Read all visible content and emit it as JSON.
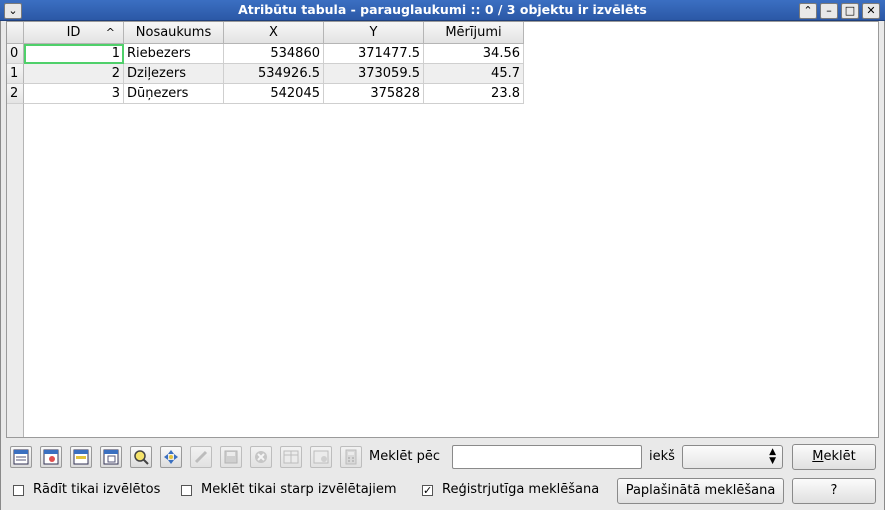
{
  "window": {
    "title": "Atribūtu tabula - parauglaukumi :: 0 / 3 objektu ir izvēlēts",
    "menu_glyph": "⌄",
    "ctrl_glyphs": {
      "shade": "⌃",
      "min": "–",
      "max": "□",
      "close": "✕"
    }
  },
  "table": {
    "columns": [
      "ID",
      "Nosaukums",
      "X",
      "Y",
      "Mērījumi"
    ],
    "sort_indicator": "^",
    "rows": [
      {
        "index": "0",
        "id": "1",
        "name": "Riebezers",
        "x": "534860",
        "y": "371477.5",
        "m": "34.56"
      },
      {
        "index": "1",
        "id": "2",
        "name": "Dziļezers",
        "x": "534926.5",
        "y": "373059.5",
        "m": "45.7"
      },
      {
        "index": "2",
        "id": "3",
        "name": "Dūņezers",
        "x": "542045",
        "y": "375828",
        "m": "23.8"
      }
    ]
  },
  "toolbar": {
    "icons": [
      "select-all-icon",
      "invert-selection-icon",
      "move-selected-to-top-icon",
      "copy-selected-icon",
      "zoom-to-selection-icon",
      "pan-to-selection-icon",
      "toggle-editing-icon",
      "save-edits-icon",
      "delete-selected-icon",
      "new-column-icon",
      "delete-column-icon",
      "field-calculator-icon"
    ],
    "search_label": "Meklēt pēc",
    "search_value": "",
    "in_label": "iekš",
    "field_value": "",
    "search_button": "Meklēt",
    "search_button_mnemonic": "M",
    "search_button_rest": "eklēt"
  },
  "options": {
    "show_selected_only": {
      "label": "Rādīt tikai izvēlētos",
      "checked": false
    },
    "search_selected_only": {
      "label": "Meklēt tikai starp izvēlētajiem",
      "checked": false
    },
    "case_sensitive": {
      "label": "Reģistrjutīga meklēšana",
      "checked": true,
      "mark": "✓"
    },
    "advanced_search_button": "Paplašinātā meklēšana",
    "help_button": "?"
  },
  "colors": {
    "titlebar": "#2b58a6",
    "focus_outline": "#4fd06a"
  }
}
